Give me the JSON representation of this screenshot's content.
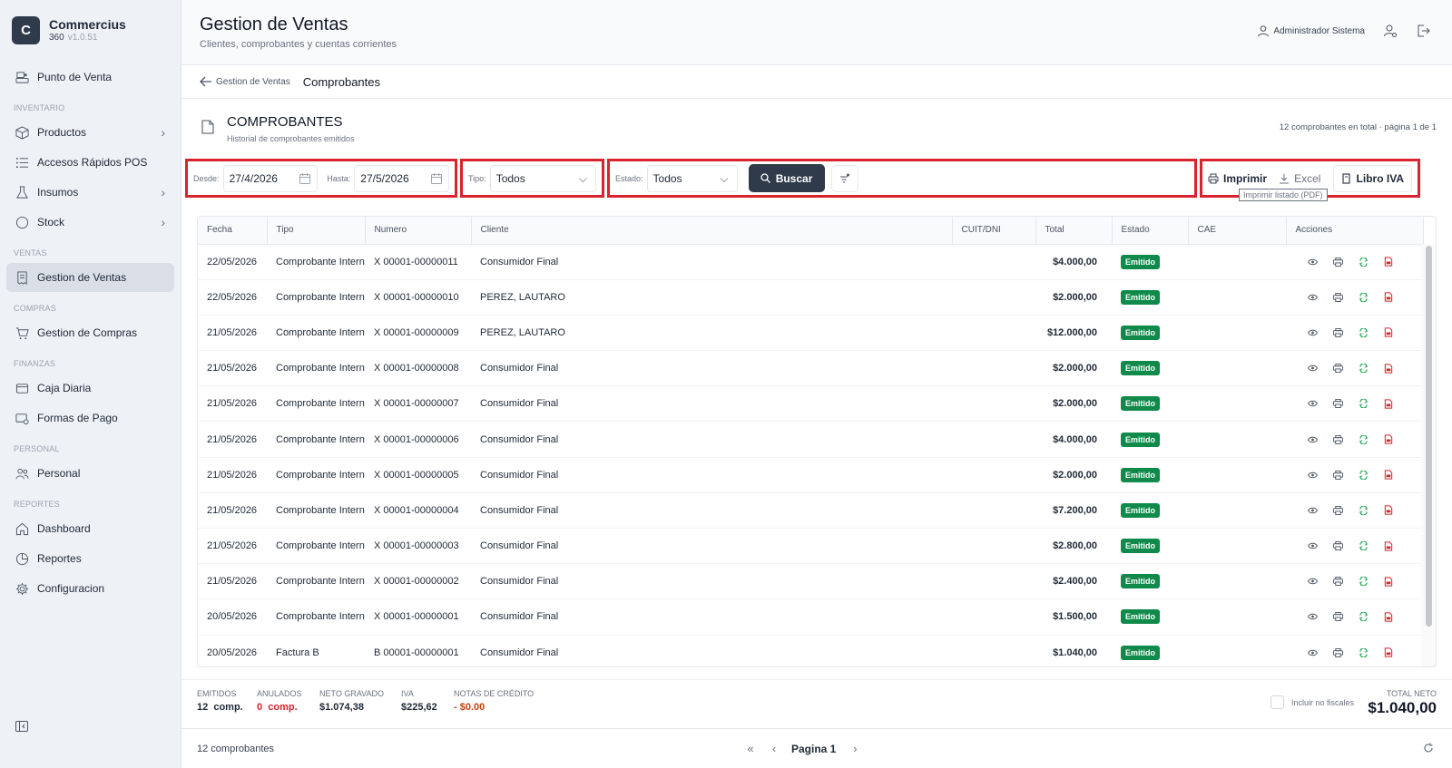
{
  "brand": {
    "name": "Commercius",
    "sub": "360",
    "version": "v1.0.51",
    "logo_letter": "C"
  },
  "sidebar": {
    "items": [
      {
        "id": "punto-de-venta",
        "label": "Punto de Venta",
        "icon": "pos-icon"
      },
      {
        "section": "INVENTARIO"
      },
      {
        "id": "productos",
        "label": "Productos",
        "icon": "box-icon",
        "chevron": true
      },
      {
        "id": "accesos-rapidos",
        "label": "Accesos Rápidos POS",
        "icon": "list-icon"
      },
      {
        "id": "insumos",
        "label": "Insumos",
        "icon": "flask-icon",
        "chevron": true
      },
      {
        "id": "stock",
        "label": "Stock",
        "icon": "circle-icon",
        "chevron": true
      },
      {
        "section": "VENTAS"
      },
      {
        "id": "gestion-ventas",
        "label": "Gestion de Ventas",
        "icon": "receipt-icon",
        "active": true
      },
      {
        "section": "COMPRAS"
      },
      {
        "id": "gestion-compras",
        "label": "Gestion de Compras",
        "icon": "cart-icon"
      },
      {
        "section": "FINANZAS"
      },
      {
        "id": "caja-diaria",
        "label": "Caja Diaria",
        "icon": "wallet-icon"
      },
      {
        "id": "formas-pago",
        "label": "Formas de Pago",
        "icon": "card-icon"
      },
      {
        "section": "PERSONAL"
      },
      {
        "id": "personal",
        "label": "Personal",
        "icon": "users-icon"
      },
      {
        "section": "REPORTES"
      },
      {
        "id": "dashboard",
        "label": "Dashboard",
        "icon": "home-icon"
      },
      {
        "id": "reportes",
        "label": "Reportes",
        "icon": "report-icon"
      },
      {
        "id": "configuracion",
        "label": "Configuracion",
        "icon": "gear-icon"
      }
    ]
  },
  "header": {
    "title": "Gestion de Ventas",
    "subtitle": "Clientes, comprobantes y cuentas corrientes",
    "user": "Administrador Sistema"
  },
  "breadcrumb": {
    "back_label": "Gestion de Ventas",
    "current": "Comprobantes"
  },
  "section": {
    "title": "COMPROBANTES",
    "subtitle": "Historial de comprobantes emitidos",
    "count_text": "12 comprobantes en total · página 1 de 1"
  },
  "filters": {
    "desde_label": "Desde:",
    "desde_value": "27/4/2026",
    "hasta_label": "Hasta:",
    "hasta_value": "27/5/2026",
    "tipo_label": "Tipo:",
    "tipo_value": "Todos",
    "estado_label": "Estado:",
    "estado_value": "Todos",
    "buscar_label": "Buscar",
    "imprimir_label": "Imprimir",
    "excel_label": "Excel",
    "libro_iva_label": "Libro IVA",
    "tooltip": "Imprimir listado (PDF)"
  },
  "table": {
    "columns": [
      "Fecha",
      "Tipo",
      "Numero",
      "Cliente",
      "CUIT/DNI",
      "Total",
      "Estado",
      "CAE",
      "Acciones"
    ],
    "rows": [
      {
        "fecha": "22/05/2026",
        "tipo": "Comprobante Interno",
        "numero": "X 00001-00000011",
        "cliente": "Consumidor Final",
        "cuit": "",
        "total": "$4.000,00",
        "estado": "Emitido",
        "cae": ""
      },
      {
        "fecha": "22/05/2026",
        "tipo": "Comprobante Interno",
        "numero": "X 00001-00000010",
        "cliente": "PEREZ, LAUTARO",
        "cuit": "",
        "total": "$2.000,00",
        "estado": "Emitido",
        "cae": ""
      },
      {
        "fecha": "21/05/2026",
        "tipo": "Comprobante Interno",
        "numero": "X 00001-00000009",
        "cliente": "PEREZ, LAUTARO",
        "cuit": "",
        "total": "$12.000,00",
        "estado": "Emitido",
        "cae": ""
      },
      {
        "fecha": "21/05/2026",
        "tipo": "Comprobante Interno",
        "numero": "X 00001-00000008",
        "cliente": "Consumidor Final",
        "cuit": "",
        "total": "$2.000,00",
        "estado": "Emitido",
        "cae": ""
      },
      {
        "fecha": "21/05/2026",
        "tipo": "Comprobante Interno",
        "numero": "X 00001-00000007",
        "cliente": "Consumidor Final",
        "cuit": "",
        "total": "$2.000,00",
        "estado": "Emitido",
        "cae": ""
      },
      {
        "fecha": "21/05/2026",
        "tipo": "Comprobante Interno",
        "numero": "X 00001-00000006",
        "cliente": "Consumidor Final",
        "cuit": "",
        "total": "$4.000,00",
        "estado": "Emitido",
        "cae": ""
      },
      {
        "fecha": "21/05/2026",
        "tipo": "Comprobante Interno",
        "numero": "X 00001-00000005",
        "cliente": "Consumidor Final",
        "cuit": "",
        "total": "$2.000,00",
        "estado": "Emitido",
        "cae": ""
      },
      {
        "fecha": "21/05/2026",
        "tipo": "Comprobante Interno",
        "numero": "X 00001-00000004",
        "cliente": "Consumidor Final",
        "cuit": "",
        "total": "$7.200,00",
        "estado": "Emitido",
        "cae": ""
      },
      {
        "fecha": "21/05/2026",
        "tipo": "Comprobante Interno",
        "numero": "X 00001-00000003",
        "cliente": "Consumidor Final",
        "cuit": "",
        "total": "$2.800,00",
        "estado": "Emitido",
        "cae": ""
      },
      {
        "fecha": "21/05/2026",
        "tipo": "Comprobante Interno",
        "numero": "X 00001-00000002",
        "cliente": "Consumidor Final",
        "cuit": "",
        "total": "$2.400,00",
        "estado": "Emitido",
        "cae": ""
      },
      {
        "fecha": "20/05/2026",
        "tipo": "Comprobante Interno",
        "numero": "X 00001-00000001",
        "cliente": "Consumidor Final",
        "cuit": "",
        "total": "$1.500,00",
        "estado": "Emitido",
        "cae": ""
      },
      {
        "fecha": "20/05/2026",
        "tipo": "Factura B",
        "numero": "B 00001-00000001",
        "cliente": "Consumidor Final",
        "cuit": "",
        "total": "$1.040,00",
        "estado": "Emitido",
        "cae": ""
      }
    ]
  },
  "summary": {
    "emitidos_label": "EMITIDOS",
    "emitidos_value": "12  comp.",
    "anulados_label": "ANULADOS",
    "anulados_value": "0  comp.",
    "neto_label": "NETO GRAVADO",
    "neto_value": "$1.074,38",
    "iva_label": "IVA",
    "iva_value": "$225,62",
    "notas_label": "NOTAS DE CRÉDITO",
    "notas_value": "- $0.00",
    "incluir_label": "Incluir no fiscales",
    "total_label": "TOTAL NETO",
    "total_value": "$1.040,00"
  },
  "footer": {
    "count": "12 comprobantes",
    "page_label": "Pagina 1"
  },
  "colors": {
    "accent": "#2f3a4a",
    "badge": "#0f8a4a",
    "highlight": "#d9232e",
    "danger": "#d9232e"
  }
}
